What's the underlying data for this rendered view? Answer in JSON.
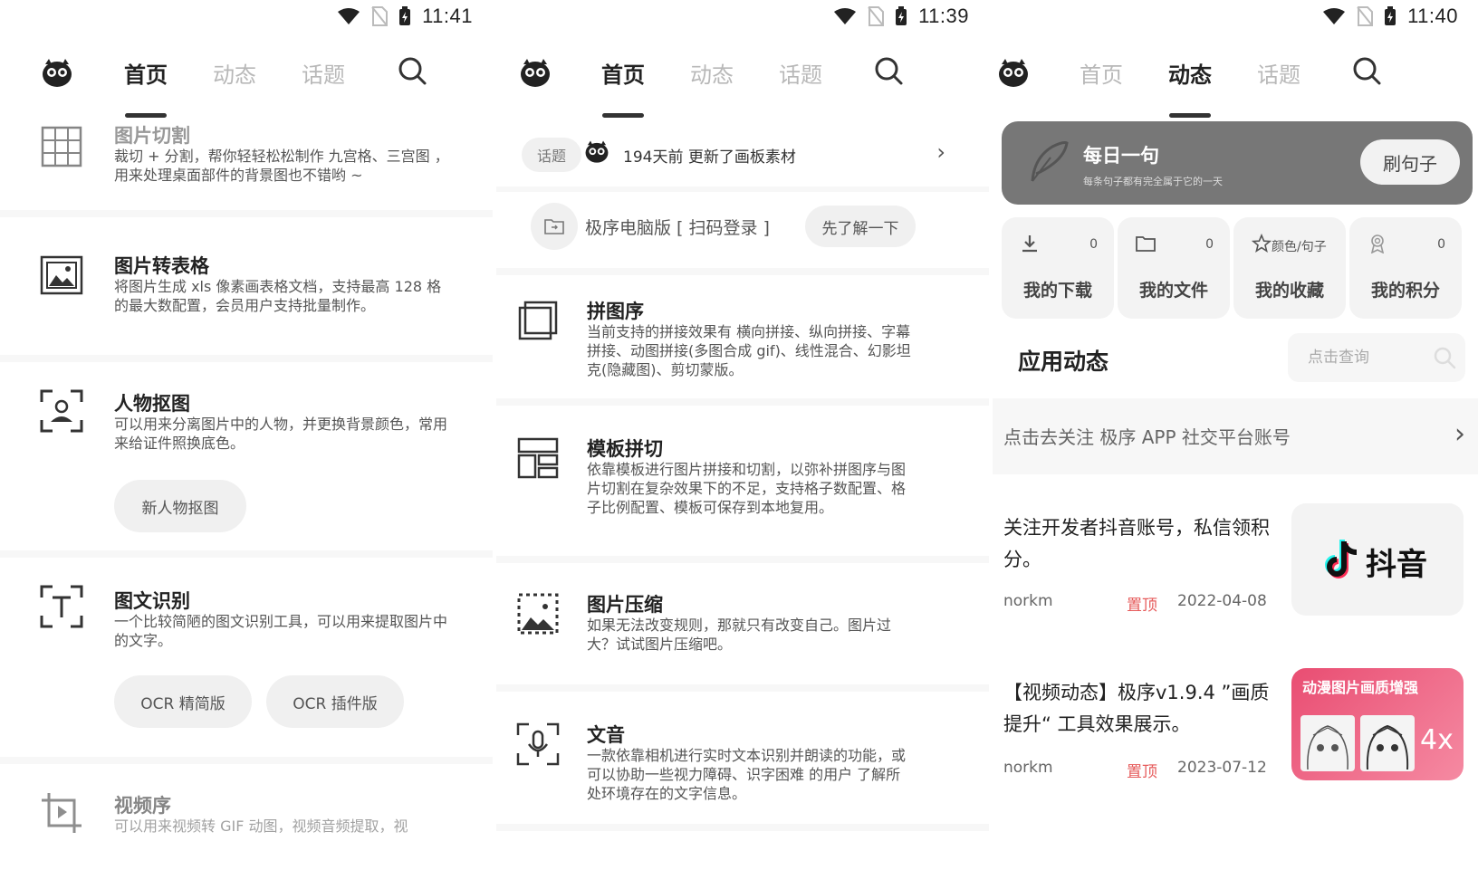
{
  "panels": [
    {
      "time": "11:41",
      "tabs": [
        "首页",
        "动态",
        "话题"
      ],
      "active_tab": 0,
      "tools": [
        {
          "title": "图片切割",
          "desc": "裁切 + 分割，帮你轻轻松松制作 九宫格、三宫图 ，用来处理桌面部件的背景图也不错哟 ~",
          "icon": "grid-icon"
        },
        {
          "title": "图片转表格",
          "desc": "将图片生成 xls 像素画表格文档，支持最高 128 格的最大数配置，会员用户支持批量制作。",
          "icon": "image-frame-icon"
        },
        {
          "title": "人物抠图",
          "desc": "可以用来分离图片中的人物，并更换背景颜色，常用来给证件照换底色。",
          "icon": "person-focus-icon",
          "buttons": [
            "新人物抠图"
          ]
        },
        {
          "title": "图文识别",
          "desc": "一个比较简陋的图文识别工具，可以用来提取图片中的文字。",
          "icon": "text-scan-icon",
          "buttons": [
            "OCR 精简版",
            "OCR 插件版"
          ]
        },
        {
          "title": "视频序",
          "desc": "可以用来视频转 GIF 动图，视频音频提取，视",
          "icon": "video-crop-icon"
        }
      ]
    },
    {
      "time": "11:39",
      "tabs": [
        "首页",
        "动态",
        "话题"
      ],
      "active_tab": 0,
      "topic_chip": "话题",
      "topic_text": "194天前 更新了画板素材",
      "pc_text": "极序电脑版 [ 扫码登录 ]",
      "pc_button": "先了解一下",
      "tools": [
        {
          "title": "拼图序",
          "desc": "当前支持的拼接效果有 横向拼接、纵向拼接、字幕拼接、动图拼接(多图合成 gif)、线性混合、幻影坦克(隐藏图)、剪切蒙版。",
          "icon": "layers-icon"
        },
        {
          "title": "模板拼切",
          "desc": "依靠模板进行图片拼接和切割，以弥补拼图序与图片切割在复杂效果下的不足，支持格子数配置、格子比例配置、模板可保存到本地复用。",
          "icon": "template-icon"
        },
        {
          "title": "图片压缩",
          "desc": "如果无法改变规则，那就只有改变自己。图片过大？试试图片压缩吧。",
          "icon": "compress-icon"
        },
        {
          "title": "文音",
          "desc": "一款依靠相机进行实时文本识别并朗读的功能，或可以协助一些视力障碍、识字困难 的用户 了解所处环境存在的文字信息。",
          "icon": "mic-scan-icon"
        }
      ]
    },
    {
      "time": "11:40",
      "tabs": [
        "首页",
        "动态",
        "话题"
      ],
      "active_tab": 1,
      "daily": {
        "title": "每日一句",
        "subtitle": "每条句子都有完全属于它的一天",
        "button": "刷句子"
      },
      "stats": [
        {
          "label": "我的下载",
          "count": "0",
          "icon": "download-icon"
        },
        {
          "label": "我的文件",
          "count": "0",
          "icon": "folder-icon"
        },
        {
          "label": "我的收藏",
          "count": "",
          "sub": "颜色/句子",
          "icon": "star-icon"
        },
        {
          "label": "我的积分",
          "count": "0",
          "icon": "medal-icon"
        }
      ],
      "section_title": "应用动态",
      "query_placeholder": "点击查询",
      "follow_text": "点击去关注 极序 APP 社交平台账号",
      "news": [
        {
          "title": "关注开发者抖音账号，私信领积分。",
          "author": "norkm",
          "pin": "置顶",
          "date": "2022-04-08",
          "thumb": "douyin",
          "thumb_text": "抖音"
        },
        {
          "title": "【视频动态】极序v1.9.4 ”画质提升“ 工具效果展示。",
          "author": "norkm",
          "pin": "置顶",
          "date": "2023-07-12",
          "thumb": "anime",
          "thumb_text": "动漫图片画质增强",
          "thumb_badge": "4x"
        }
      ]
    }
  ]
}
